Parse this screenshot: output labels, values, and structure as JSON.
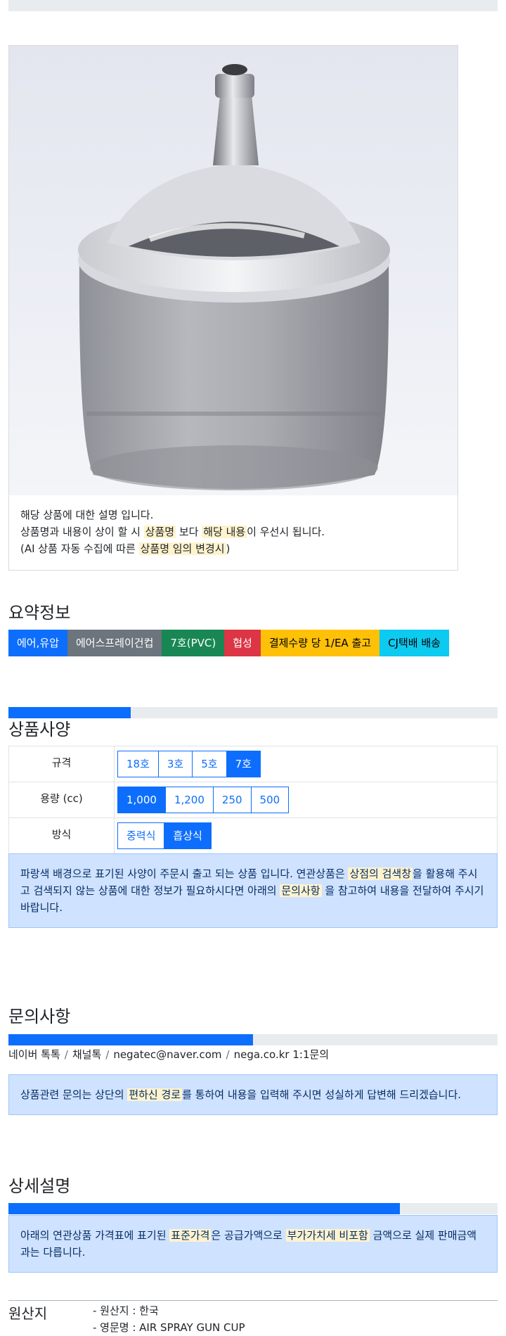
{
  "product_card": {
    "line1": "해당 상품에 대한 설명 입니다.",
    "line2_a": "상품명과 내용이 상이 할 시 ",
    "line2_hl1": "상품명",
    "line2_b": " 보다 ",
    "line2_hl2": "해당 내용",
    "line2_c": "이 우선시 됩니다.",
    "line3_a": "(AI 상품 자동 수집에 따른 ",
    "line3_hl": "상품명 임의 변경시",
    "line3_b": ")"
  },
  "summary": {
    "title": "요약정보",
    "badges": [
      "에어,유압",
      "에어스프레이건컵",
      "7호(PVC)",
      "협성",
      "결제수량 당 1/EA 출고",
      "CJ택배 배송"
    ]
  },
  "spec": {
    "progress": 0.25,
    "title": "상품사양",
    "rows": [
      {
        "label": "규격",
        "options": [
          "18호",
          "3호",
          "5호",
          "7호"
        ],
        "active": "7호"
      },
      {
        "label": "용량 (cc)",
        "options": [
          "1,000",
          "1,200",
          "250",
          "500"
        ],
        "active": "1,000"
      },
      {
        "label": "방식",
        "options": [
          "중력식",
          "흡상식"
        ],
        "active": "흡상식"
      }
    ],
    "notice_a": "파랑색 배경으로 표기된 사양이 주문시 출고 되는 상품 입니다. 연관상품은 ",
    "notice_hl1": "상점의 검색창",
    "notice_b": "을 활용해 주시고 검색되지 않는 상품에 대한 정보가 필요하시다면 아래의 ",
    "notice_hl2": "문의사항",
    "notice_c": " 을 참고하여 내용을 전달하여 주시기 바랍니다."
  },
  "inquiry": {
    "title": "문의사항",
    "progress": 0.5,
    "contacts": [
      "네이버 톡톡",
      "채널톡",
      "negatec@naver.com",
      "nega.co.kr 1:1문의"
    ],
    "separator": "/",
    "notice_a": "상품관련 문의는 상단의 ",
    "notice_hl": "편하신 경로",
    "notice_b": "를 통하여 내용을 입력해 주시면 성실하게 답변해 드리겠습니다."
  },
  "detail": {
    "title": "상세설명",
    "progress": 0.8,
    "notice_a": "아래의 연관상품 가격표에 표기된 ",
    "notice_hl1": "표준가격",
    "notice_b": "은 공급가액으로 ",
    "notice_hl2": "부가가치세 비포함",
    "notice_c": " 금액으로 실제 판매금액과는 다릅니다."
  },
  "origin": {
    "label": "원산지",
    "items": [
      "- 원산지 : 한국",
      "- 영문명 : AIR SPRAY GUN CUP"
    ]
  },
  "colors": {
    "primary": "#0d6efd",
    "alert_bg": "#cfe2ff",
    "highlight": "#fff3cd"
  },
  "icons": {
    "product_photo": "spray-gun-cup-photo"
  }
}
